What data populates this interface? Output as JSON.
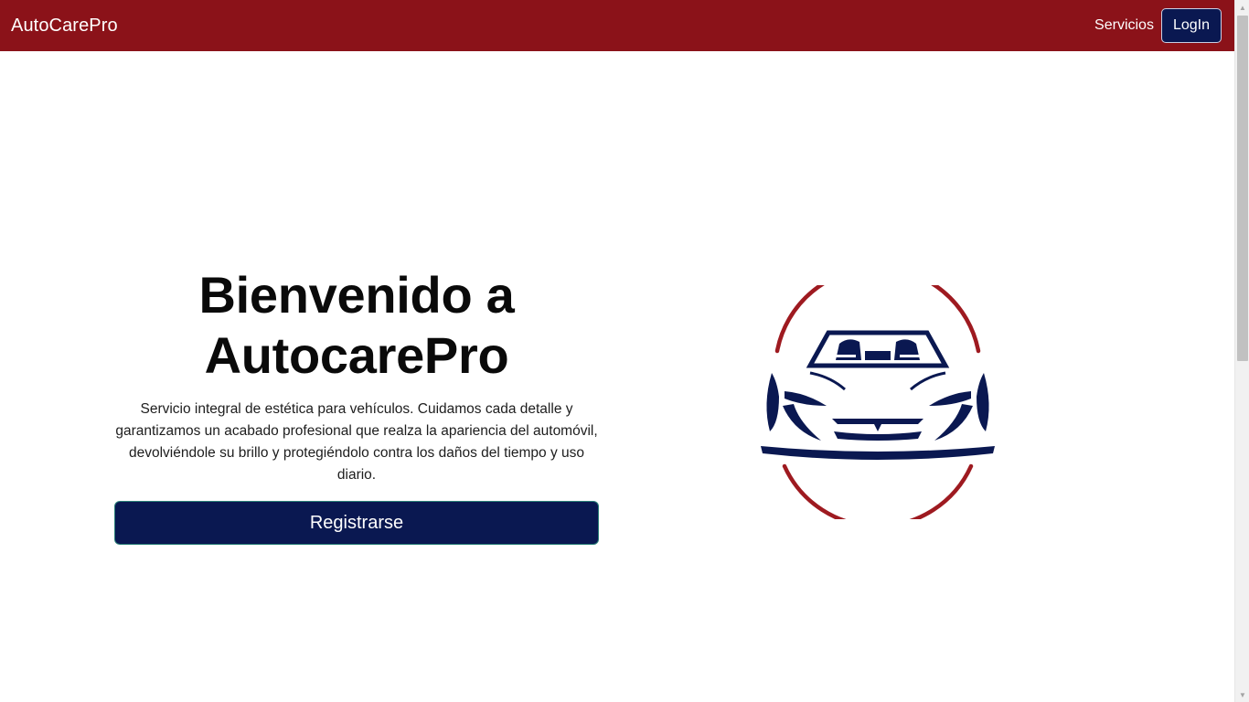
{
  "navbar": {
    "brand": "AutoCarePro",
    "services_link": "Servicios",
    "login_button": "LogIn"
  },
  "hero": {
    "title_line1": "Bienvenido a",
    "title_line2": "AutocarePro",
    "description": "Servicio integral de estética para vehículos. Cuidamos cada detalle y garantizamos un acabado profesional que realza la apariencia del automóvil, devolviéndole su brillo y protegiéndolo contra los daños del tiempo y uso diario.",
    "register_button": "Registrarse"
  },
  "logo": {
    "icon": "car-front-logo-icon"
  },
  "colors": {
    "navbar": "#8b1219",
    "primary": "#0a1851",
    "ring": "#9e1a20"
  },
  "scrollbar": {
    "up_icon": "scroll-up-arrow-icon",
    "down_icon": "scroll-down-arrow-icon"
  }
}
